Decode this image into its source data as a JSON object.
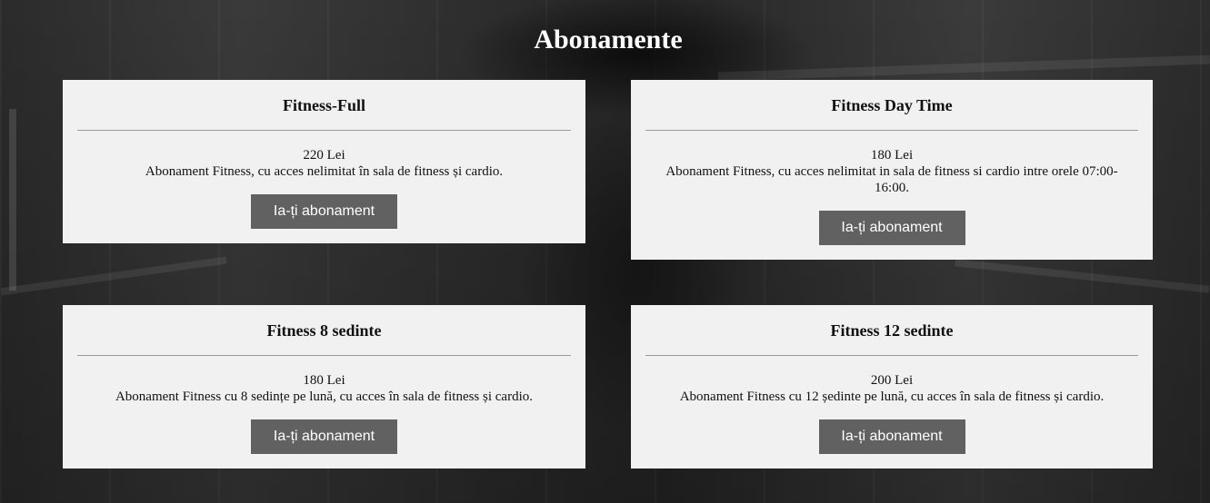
{
  "page": {
    "title": "Abonamente"
  },
  "plans": [
    {
      "name": "Fitness-Full",
      "price": "220 Lei",
      "description": "Abonament Fitness, cu acces nelimitat în sala de fitness și cardio.",
      "button_label": "Ia-ți abonament"
    },
    {
      "name": "Fitness Day Time",
      "price": "180 Lei",
      "description": "Abonament Fitness, cu acces nelimitat in sala de fitness si cardio intre orele 07:00-16:00.",
      "button_label": "Ia-ți abonament"
    },
    {
      "name": "Fitness 8 sedinte",
      "price": "180 Lei",
      "description": "Abonament Fitness cu 8 sedințe pe lună, cu acces în sala de fitness și cardio.",
      "button_label": "Ia-ți abonament"
    },
    {
      "name": "Fitness 12 sedinte",
      "price": "200 Lei",
      "description": "Abonament Fitness cu 12 ședinte pe lună, cu acces în sala de fitness și cardio.",
      "button_label": "Ia-ți abonament"
    }
  ],
  "colors": {
    "card_background": "#f1f1f1",
    "button_background": "#616161",
    "button_text": "#ffffff",
    "title_text": "#ffffff"
  }
}
